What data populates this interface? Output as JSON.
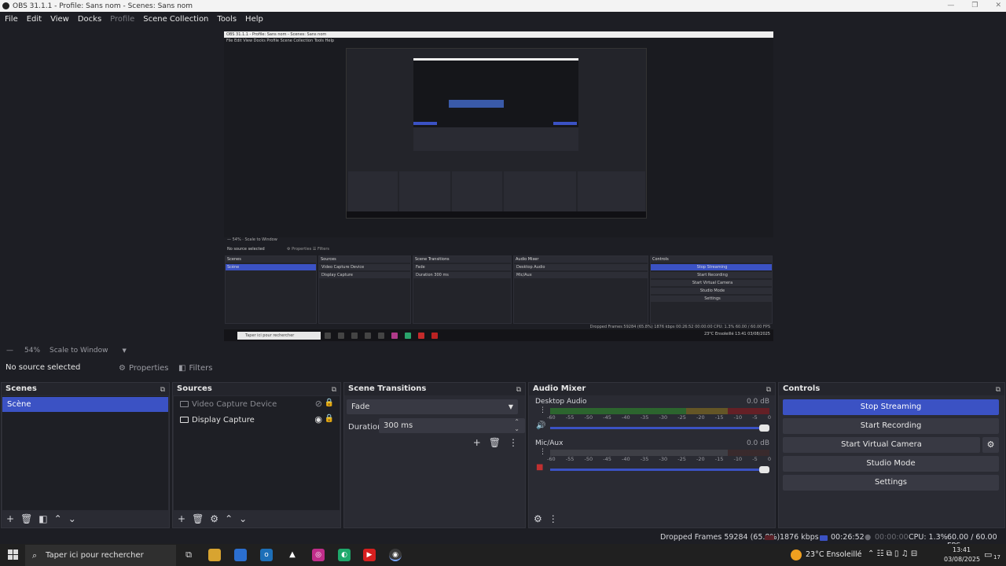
{
  "window": {
    "title": "OBS 31.1.1 - Profile: Sans nom - Scenes: Sans nom",
    "controls": [
      "—",
      "❐",
      "✕"
    ]
  },
  "menu": [
    "File",
    "Edit",
    "View",
    "Docks",
    "Profile",
    "Scene Collection",
    "Tools",
    "Help"
  ],
  "preview_nested": {
    "title": "OBS 31.1.1 - Profile: Sans nom - Scenes: Sans nom",
    "menu": "File   Edit   View   Docks   Profile   Scene Collection   Tools   Help",
    "zoom": "— 54%  ·  Scale to Window",
    "no_source": "No source selected",
    "tabs": "⚙ Properties     ☰ Filters",
    "panels": {
      "scenes": "Scenes",
      "scene_item": "Scène",
      "sources": "Sources",
      "src1": "Video Capture Device",
      "src2": "Display Capture",
      "transitions": "Scene Transitions",
      "fade": "Fade",
      "duration": "Duration   300 ms",
      "mixer": "Audio Mixer",
      "ch1": "Desktop Audio",
      "ch2": "Mic/Aux",
      "controls": "Controls",
      "c1": "Stop Streaming",
      "c2": "Start Recording",
      "c3": "Start Virtual Camera",
      "c4": "Studio Mode",
      "c5": "Settings"
    },
    "status": "Dropped Frames 59284 (65.8%)   1876 kbps   00:26:52   00:00:00   CPU: 1.3%   60.00 / 60.00 FPS",
    "taskbar_search": "Taper ici pour rechercher",
    "taskbar_right": "23°C Ensoleillé   13:41  03/08/2025"
  },
  "zoom": {
    "minus": "—",
    "level": "54%",
    "mode": "Scale to Window",
    "caret": "▼"
  },
  "source_bar": {
    "no_source": "No source selected",
    "properties": "Properties",
    "filters": "Filters"
  },
  "scenes": {
    "title": "Scenes",
    "items": [
      "Scène"
    ]
  },
  "sources": {
    "title": "Sources",
    "items": [
      {
        "name": "Video Capture Device",
        "visible": false
      },
      {
        "name": "Display Capture",
        "visible": true
      }
    ]
  },
  "transitions": {
    "title": "Scene Transitions",
    "selected": "Fade",
    "duration_label": "Duration",
    "duration_value": "300 ms"
  },
  "mixer": {
    "title": "Audio Mixer",
    "ticks": [
      "-60",
      "-55",
      "-50",
      "-45",
      "-40",
      "-35",
      "-30",
      "-25",
      "-20",
      "-15",
      "-10",
      "-5",
      "0"
    ],
    "channels": [
      {
        "name": "Desktop Audio",
        "db": "0.0 dB",
        "level": 0.0
      },
      {
        "name": "Mic/Aux",
        "db": "0.0 dB",
        "level": 0.0
      }
    ]
  },
  "controls": {
    "title": "Controls",
    "stop_streaming": "Stop Streaming",
    "start_recording": "Start Recording",
    "start_virtual_camera": "Start Virtual Camera",
    "studio_mode": "Studio Mode",
    "settings": "Settings"
  },
  "status": {
    "dropped": "Dropped Frames 59284 (65.8%)",
    "kbps": "1876 kbps",
    "stream_time": "00:26:52",
    "rec_time": "00:00:00",
    "cpu": "CPU: 1.3%",
    "fps": "60.00 / 60.00 FPS"
  },
  "taskbar": {
    "search_placeholder": "Taper ici pour rechercher",
    "weather": "23°C  Ensoleillé",
    "time": "13:41",
    "date": "03/08/2025",
    "notif_count": "17"
  },
  "colors": {
    "accent": "#3b52c4",
    "panel": "#2a2b33",
    "background": "#1d1e24"
  }
}
